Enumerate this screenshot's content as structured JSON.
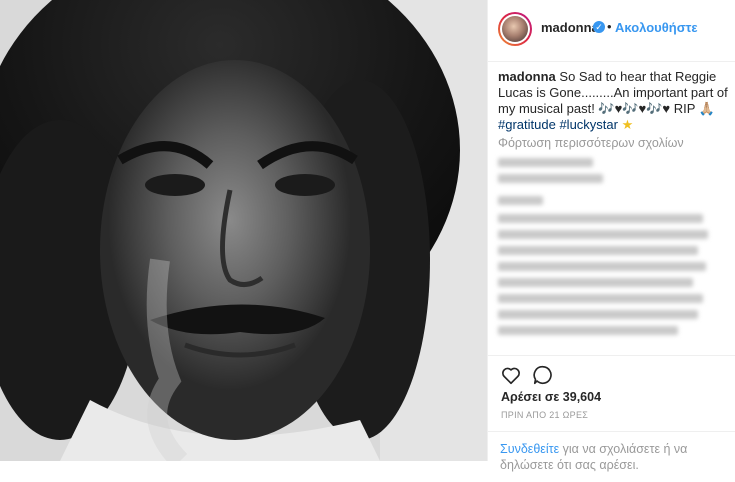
{
  "post": {
    "username": "madonna",
    "verified_icon": "verified-badge-icon",
    "follow_label": "Ακολουθήστε",
    "caption_text_1": "So Sad to hear that Reggie Lucas is Gone.........An important part of my musical past! ",
    "caption_emoji": "🎶♥🎶♥🎶♥",
    "caption_text_2": " RIP ",
    "caption_emoji_2": "🙏🏼",
    "hashtag_1": "#gratitude",
    "hashtag_2": "#luckystar",
    "caption_star": "★",
    "load_more": "Φόρτωση περισσότερων σχολίων",
    "likes": "Αρέσει σε 39,604",
    "timestamp": "ΠΡΙΝ ΑΠΟ 21 ΩΡΕΣ",
    "login_link": "Συνδεθείτε",
    "login_text": " για να σχολιάσετε ή να δηλώσετε ότι σας αρέσει."
  },
  "colors": {
    "link": "#3897f0",
    "hashtag": "#003569",
    "muted": "#999999",
    "text": "#262626"
  }
}
